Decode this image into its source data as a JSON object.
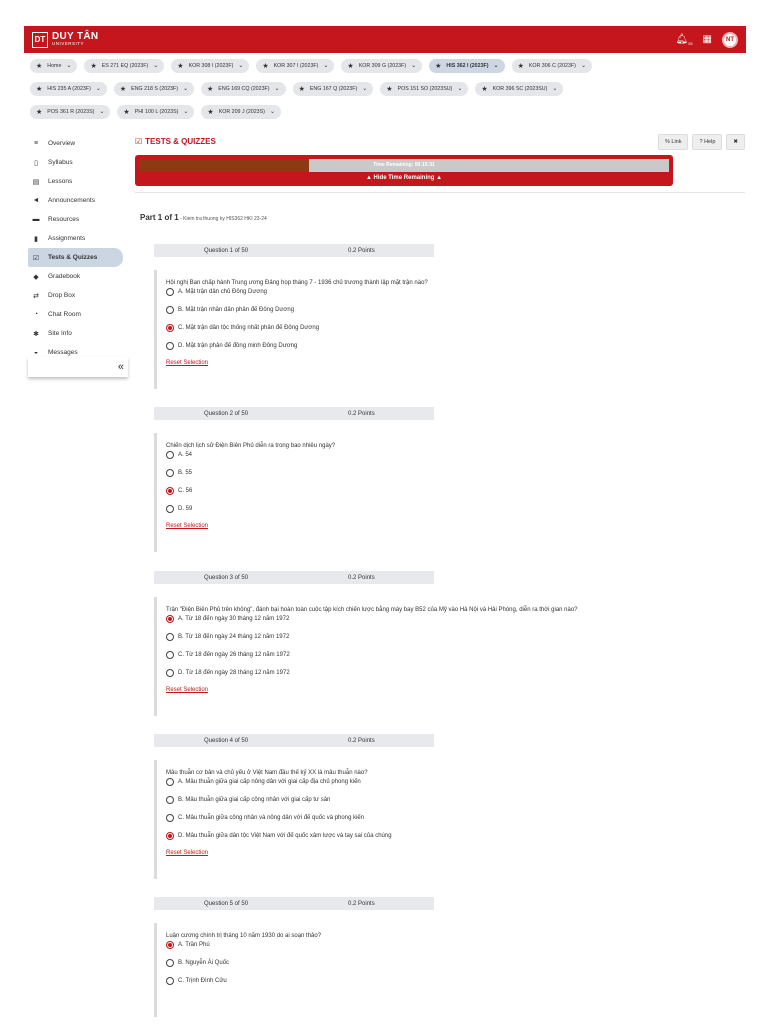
{
  "brand": {
    "name": "DUY TÂN",
    "sub": "UNIVERSITY",
    "logo_mark": "DT"
  },
  "topbar": {
    "bell_count": "25",
    "avatar_initials": "NT"
  },
  "tabs_rows": [
    [
      {
        "label": "Home",
        "active": false
      },
      {
        "label": "ES 271 EQ (2023F)",
        "active": false
      },
      {
        "label": "KOR 308 I (2023F)",
        "active": false
      },
      {
        "label": "KOR 307 I (2023F)",
        "active": false
      },
      {
        "label": "KOR 309 G (2023F)",
        "active": false
      },
      {
        "label": "HIS 362 I (2023F)",
        "active": true
      },
      {
        "label": "KOR 306 C (2023F)",
        "active": false
      }
    ],
    [
      {
        "label": "HIS 235 A (2023F)",
        "active": false
      },
      {
        "label": "ENG 218 S (2023F)",
        "active": false
      },
      {
        "label": "ENG 169 CQ (2023F)",
        "active": false
      },
      {
        "label": "ENG 167 Q (2023F)",
        "active": false
      },
      {
        "label": "POS 151 SO (2023SU)",
        "active": false
      },
      {
        "label": "KOR 396 SC (2023SU)",
        "active": false
      }
    ],
    [
      {
        "label": "POS 361 R (2023S)",
        "active": false
      },
      {
        "label": "PHI 100 L (2023S)",
        "active": false
      },
      {
        "label": "KOR 209 J (2023S)",
        "active": false
      }
    ]
  ],
  "sidebar": {
    "items": [
      {
        "label": "Overview",
        "icon": "≡",
        "name": "overview"
      },
      {
        "label": "Syllabus",
        "icon": "▯",
        "name": "syllabus"
      },
      {
        "label": "Lessons",
        "icon": "▤",
        "name": "lessons"
      },
      {
        "label": "Announcements",
        "icon": "◄",
        "name": "announcements"
      },
      {
        "label": "Resources",
        "icon": "▬",
        "name": "resources"
      },
      {
        "label": "Assignments",
        "icon": "▮",
        "name": "assignments"
      },
      {
        "label": "Tests & Quizzes",
        "icon": "☑",
        "name": "tests-quizzes",
        "active": true
      },
      {
        "label": "Gradebook",
        "icon": "◆",
        "name": "gradebook"
      },
      {
        "label": "Drop Box",
        "icon": "⇄",
        "name": "drop-box"
      },
      {
        "label": "Chat Room",
        "icon": "◔",
        "name": "chat-room"
      },
      {
        "label": "Site Info",
        "icon": "✱",
        "name": "site-info"
      },
      {
        "label": "Messages",
        "icon": "◒",
        "name": "messages"
      }
    ],
    "collapse_glyph": "«"
  },
  "main": {
    "title": "TESTS & QUIZZES",
    "link_label": "Link",
    "help_label": "Help",
    "close_glyph": "✖",
    "timer": {
      "text": "Time Remaining: 00:15:31",
      "fraction_remaining": 0.32,
      "hide_label": "▲ Hide Time Remaining ▲"
    },
    "part": {
      "label": "Part 1 of 1",
      "desc": " - Kiem tra thuong ky HIS362 HKI 23-24"
    }
  },
  "questions": [
    {
      "header": "Question 1 of 50",
      "points": "0.2 Points",
      "text": "Hội nghị Ban chấp hành Trung ương Đảng họp tháng 7 - 1936 chủ trương thành lập mặt trận nào?",
      "options": [
        "A. Mặt trận dân chủ Đông Dương",
        "B. Mặt trận nhân dân phản đế Đông Dương",
        "C. Mặt trận dân tộc thống nhất phản đế Đông Dương",
        "D. Mặt trận phản đế đồng minh Đông Dương"
      ],
      "selected": 2,
      "reset": "Reset Selection"
    },
    {
      "header": "Question 2 of 50",
      "points": "0.2 Points",
      "text": "Chiến dịch lịch sử Điện Biên Phủ diễn ra trong bao nhiêu ngày?",
      "options": [
        "A. 54",
        "B. 55",
        "C. 56",
        "D. 59"
      ],
      "selected": 2,
      "reset": "Reset Selection"
    },
    {
      "header": "Question 3 of 50",
      "points": "0.2 Points",
      "text": "Trận \"Điện Biên Phủ trên không\", đánh bại hoàn toàn cuộc tập kích chiến lược bằng máy bay B52 của Mỹ vào Hà Nội và Hải Phòng, diễn ra thời gian nào?",
      "options": [
        "A. Từ 18 đến ngày 30 tháng 12 năm 1972",
        "B. Từ 18 đến ngày 24 tháng 12 năm 1972",
        "C. Từ 18 đến ngày 26 tháng 12 năm 1972",
        "D. Từ 18 đến ngày 28 tháng 12 năm 1972"
      ],
      "selected": 0,
      "reset": "Reset Selection"
    },
    {
      "header": "Question 4 of 50",
      "points": "0.2 Points",
      "text": "Mâu thuẫn cơ bản và chủ yếu ở Việt Nam đầu thế kỷ XX là mâu thuẫn nào?",
      "options": [
        "A. Mâu thuẫn giữa giai cấp nông dân với giai cấp địa chủ phong kiến",
        "B. Mâu thuẫn giữa giai cấp công nhân với giai cấp tư sản",
        "C. Mâu thuẫn giữa công nhân và nông dân với đế quốc và phong kiến",
        "D. Mâu thuẫn giữa dân tộc Việt Nam với đế quốc xâm lược và tay sai của chúng"
      ],
      "selected": 3,
      "reset": "Reset Selection"
    },
    {
      "header": "Question 5 of 50",
      "points": "0.2 Points",
      "text": "Luận cương chính trị tháng 10 năm 1930 do ai soạn thảo?",
      "options": [
        "A. Trần Phú",
        "B. Nguyễn Ái Quốc",
        "C. Trịnh Đình Cửu"
      ],
      "selected": 0,
      "reset": ""
    }
  ]
}
